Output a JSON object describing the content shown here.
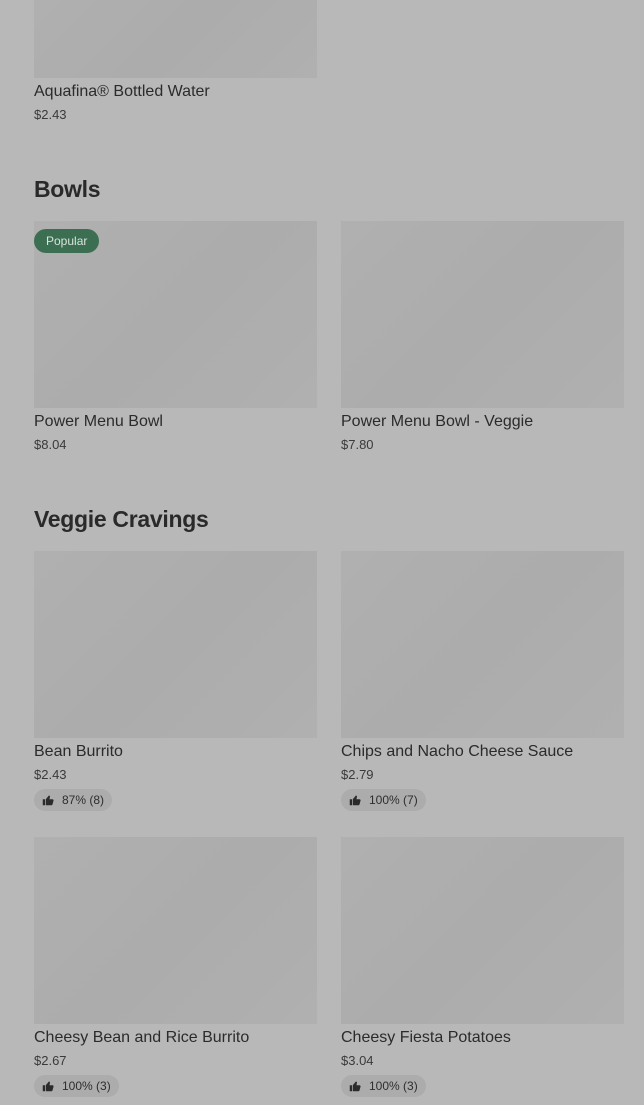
{
  "top_item": {
    "name": "Aquafina® Bottled Water",
    "price": "$2.43"
  },
  "sections": {
    "bowls": {
      "title": "Bowls",
      "items": [
        {
          "name": "Power Menu Bowl",
          "price": "$8.04",
          "badge": "Popular"
        },
        {
          "name": "Power Menu Bowl - Veggie",
          "price": "$7.80"
        }
      ]
    },
    "veggie": {
      "title": "Veggie Cravings",
      "items": [
        {
          "name": "Bean Burrito",
          "price": "$2.43",
          "rating": "87% (8)"
        },
        {
          "name": "Chips and Nacho Cheese Sauce",
          "price": "$2.79",
          "rating": "100% (7)"
        },
        {
          "name": "Cheesy Bean and Rice Burrito",
          "price": "$2.67",
          "rating": "100% (3)"
        },
        {
          "name": "Cheesy Fiesta Potatoes",
          "price": "$3.04",
          "rating": "100% (3)"
        }
      ]
    }
  },
  "icons": {
    "rating": "thumbs-up-icon"
  },
  "colors": {
    "background": "#b8b8b8",
    "badge": "#3c6e52"
  }
}
